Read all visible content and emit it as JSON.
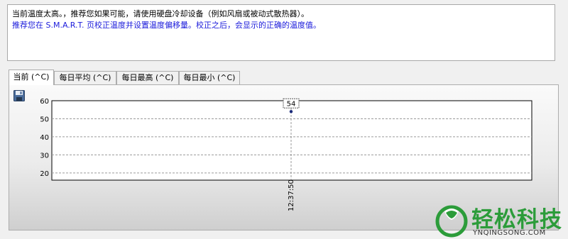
{
  "message": {
    "line1": "当前温度太高。，推荐您如果可能，请使用硬盘冷却设备（例如风扇或被动式散热器）。",
    "line2": "推荐您在 S.M.A.R.T. 页校正温度并设置温度偏移量。校正之后，会显示的正确的温度值。"
  },
  "tabs": [
    {
      "label": "当前 (^C)",
      "active": true
    },
    {
      "label": "每日平均 (^C)",
      "active": false
    },
    {
      "label": "每日最高 (^C)",
      "active": false
    },
    {
      "label": "每日最小 (^C)",
      "active": false
    }
  ],
  "toolbar": {
    "save_icon": "save-icon"
  },
  "chart_data": {
    "type": "scatter",
    "ylim": [
      16,
      60
    ],
    "yticks": [
      20,
      30,
      40,
      50,
      60
    ],
    "points": [
      {
        "x": "12:37:50",
        "y": 54,
        "label": "54"
      }
    ],
    "grid": true
  },
  "watermark": {
    "brand": "轻松科技",
    "url": "YNQINGSONG.COM"
  }
}
